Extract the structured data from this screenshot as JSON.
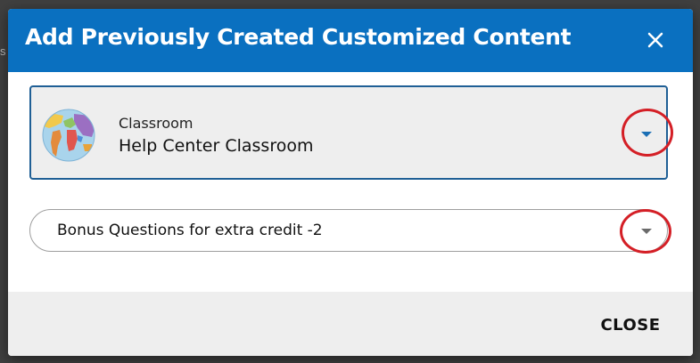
{
  "dialog": {
    "title": "Add Previously Created Customized Content",
    "close_icon": "close-icon",
    "header_color": "#0a70c0"
  },
  "classroom_select": {
    "caption": "Classroom",
    "value": "Help Center Classroom",
    "avatar_icon": "globe-icon",
    "dropdown_icon": "chevron-down-icon",
    "accent_color": "#1a6fb5"
  },
  "content_select": {
    "value": "Bonus Questions for extra credit -2",
    "dropdown_icon": "chevron-down-icon"
  },
  "annotations": {
    "highlight_color": "#d41f26",
    "shape": "red-circle"
  },
  "footer": {
    "close_label": "CLOSE"
  },
  "backdrop": {
    "partial_text": "s"
  }
}
